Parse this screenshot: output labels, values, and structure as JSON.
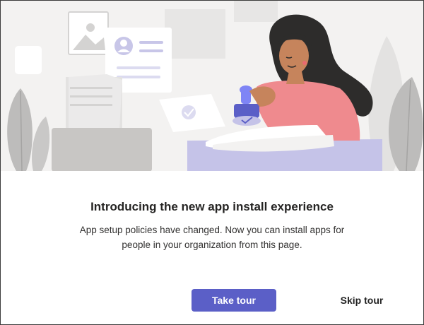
{
  "dialog": {
    "title": "Introducing the new app install experience",
    "description": "App setup policies have changed. Now you can install apps for people in your organization from this page.",
    "primary_button": "Take tour",
    "secondary_button": "Skip tour"
  },
  "colors": {
    "accent": "#5b5fc7",
    "banner_background": "#f3f2f1",
    "shirt": "#ef8a8e",
    "desk": "#c5c3e8"
  },
  "illustration": {
    "subject": "woman-stamping-document",
    "icons": [
      "image-icon",
      "profile-card-icon",
      "stamp-icon",
      "checkmark-icon",
      "leaf-icon"
    ]
  }
}
